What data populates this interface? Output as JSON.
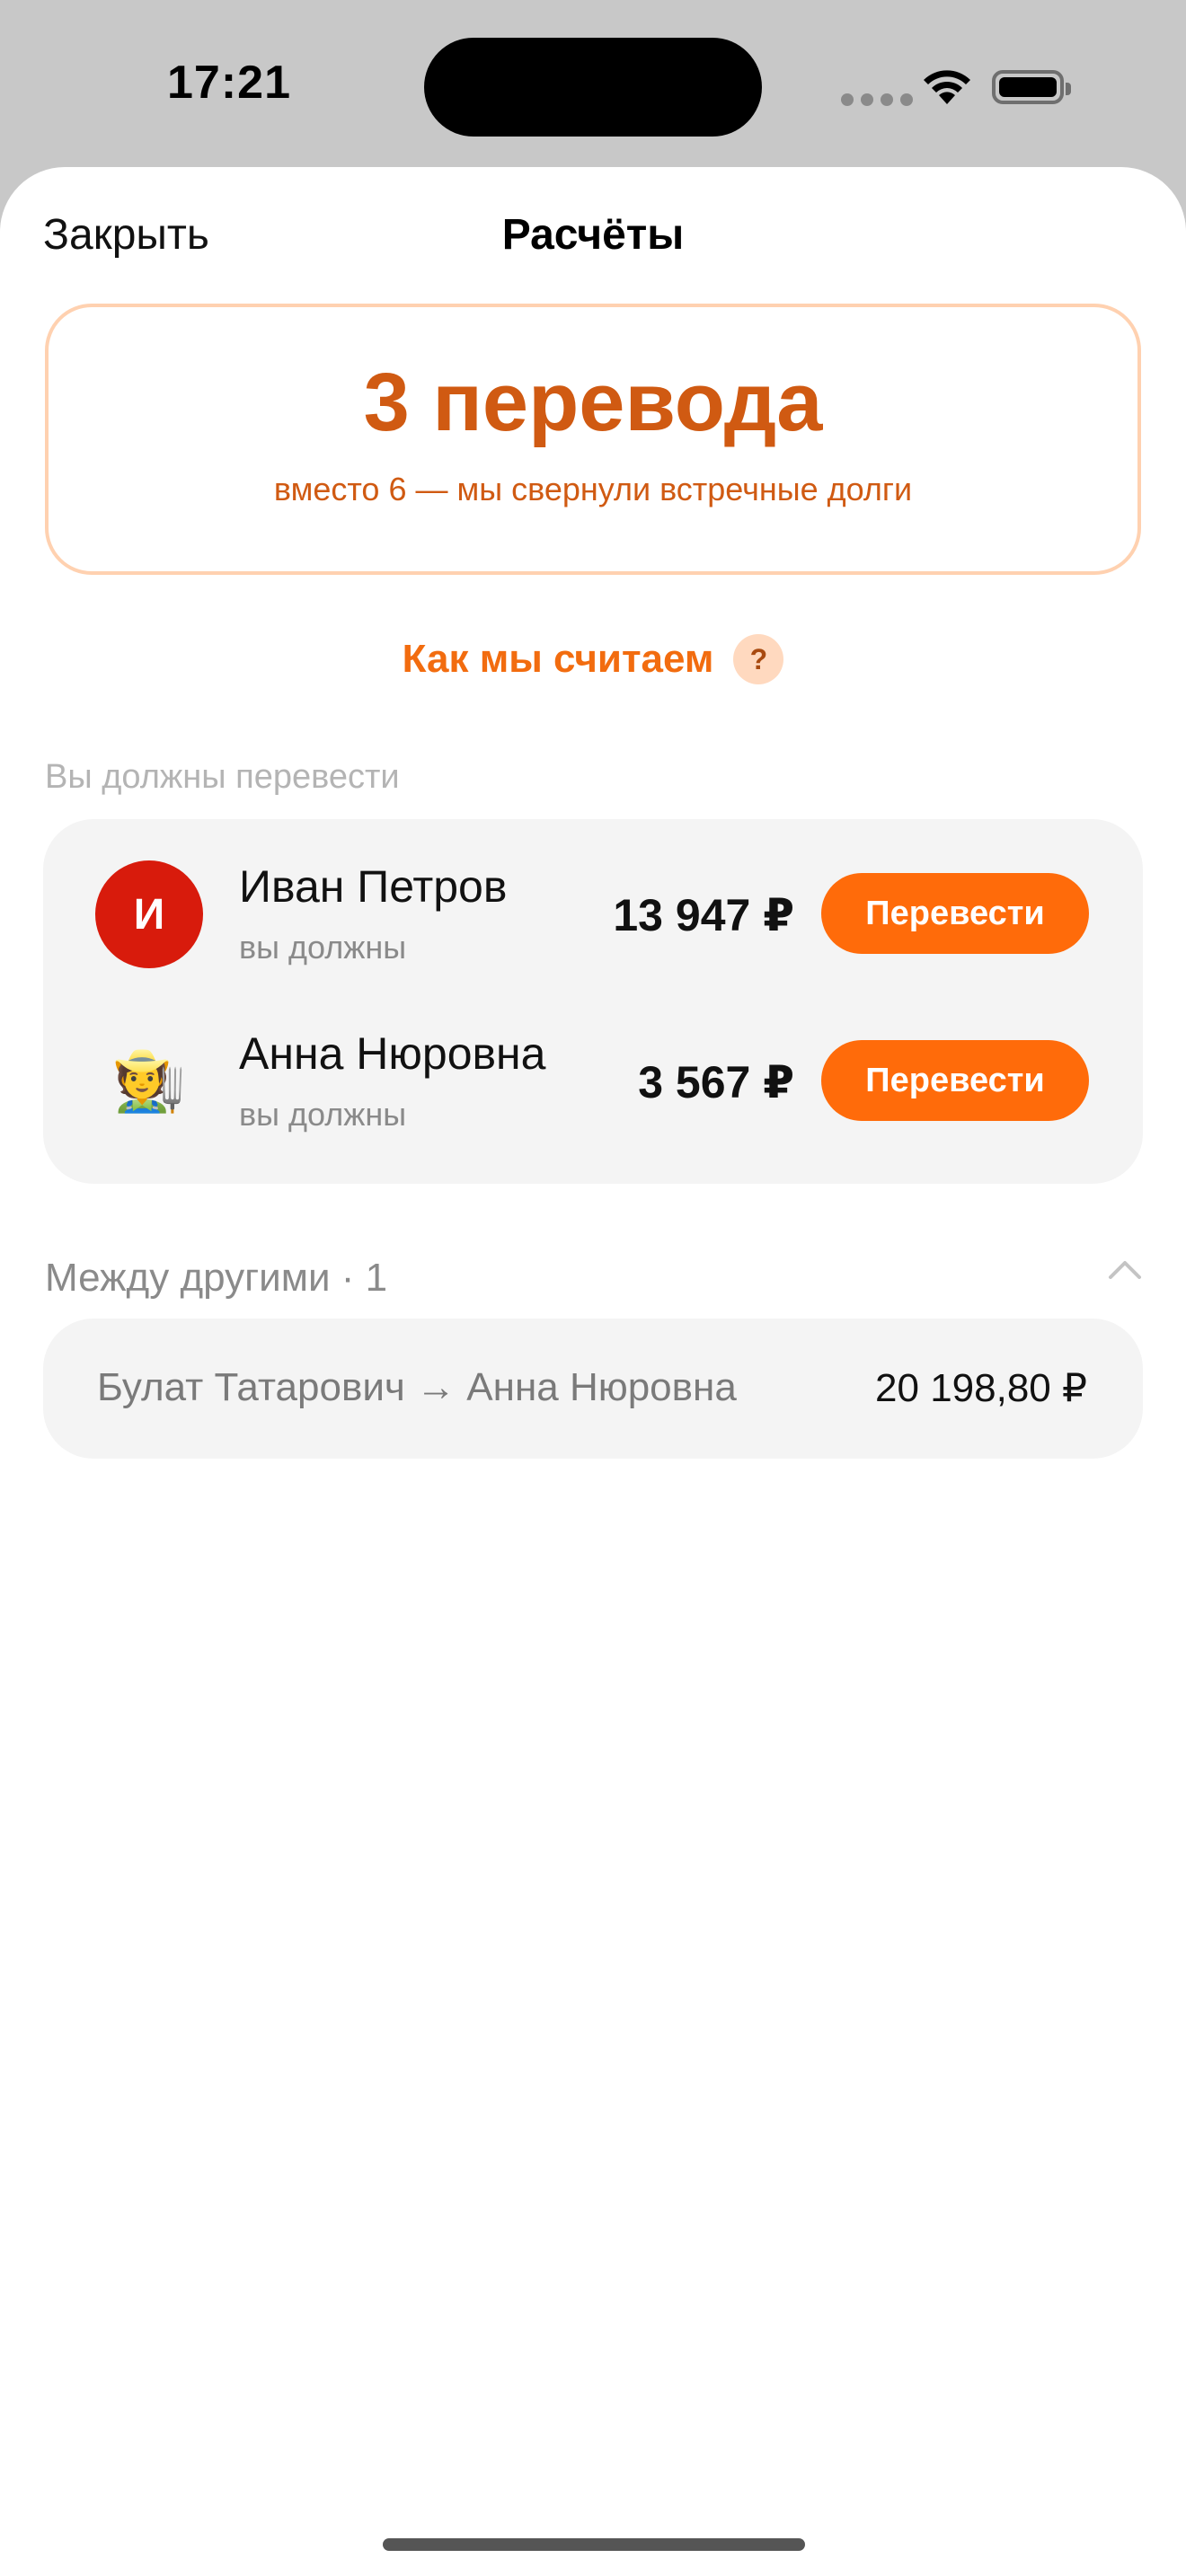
{
  "status_bar": {
    "time": "17:21"
  },
  "nav": {
    "close_label": "Закрыть",
    "title": "Расчёты"
  },
  "summary": {
    "title": "3 перевода",
    "subtitle": "вместо 6 — мы свернули встречные долги"
  },
  "how_link": {
    "label": "Как мы считаем",
    "help_mark": "?"
  },
  "you_owe": {
    "section_label": "Вы должны перевести",
    "items": [
      {
        "avatar_letter": "И",
        "avatar_color": "#d81b0c",
        "name": "Иван Петров",
        "status": "вы должны",
        "amount": "13 947 ₽",
        "button": "Перевести"
      },
      {
        "avatar_emoji": "🧑‍🌾",
        "name": "Анна Нюровна",
        "status": "вы должны",
        "amount": "3 567 ₽",
        "button": "Перевести"
      }
    ]
  },
  "others": {
    "header": "Между другими · 1",
    "items": [
      {
        "names": "Булат Татарович → Анна Нюровна",
        "amount": "20 198,80 ₽"
      }
    ]
  },
  "colors": {
    "accent": "#ff6b0a",
    "accent_text": "#d05a12",
    "card_bg": "#f4f4f4"
  }
}
